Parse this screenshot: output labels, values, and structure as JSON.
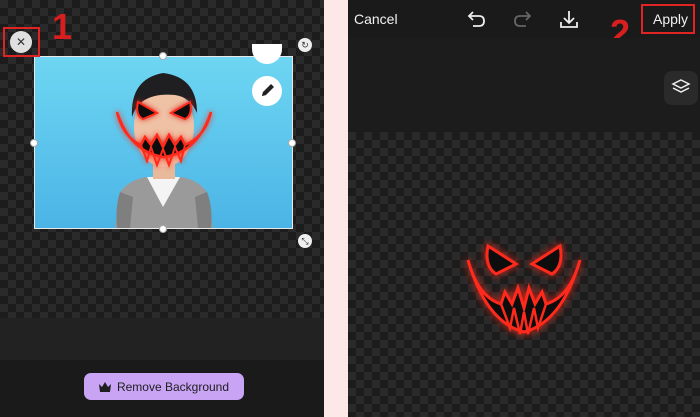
{
  "left": {
    "annotation_number": "1",
    "remove_background_label": "Remove Background",
    "delete_icon": "close-icon",
    "edit_icon": "pencil-icon"
  },
  "right": {
    "cancel_label": "Cancel",
    "apply_label": "Apply",
    "annotation_number": "2",
    "undo_icon": "undo-icon",
    "redo_icon": "redo-icon",
    "download_icon": "download-icon",
    "layers_icon": "layers-icon"
  },
  "colors": {
    "annotation_red": "#d81e1e",
    "button_purple": "#c9a4f5",
    "sky_top": "#6ed6f2",
    "sky_bottom": "#4bb4e6",
    "glow_red": "#ff2a1a"
  }
}
